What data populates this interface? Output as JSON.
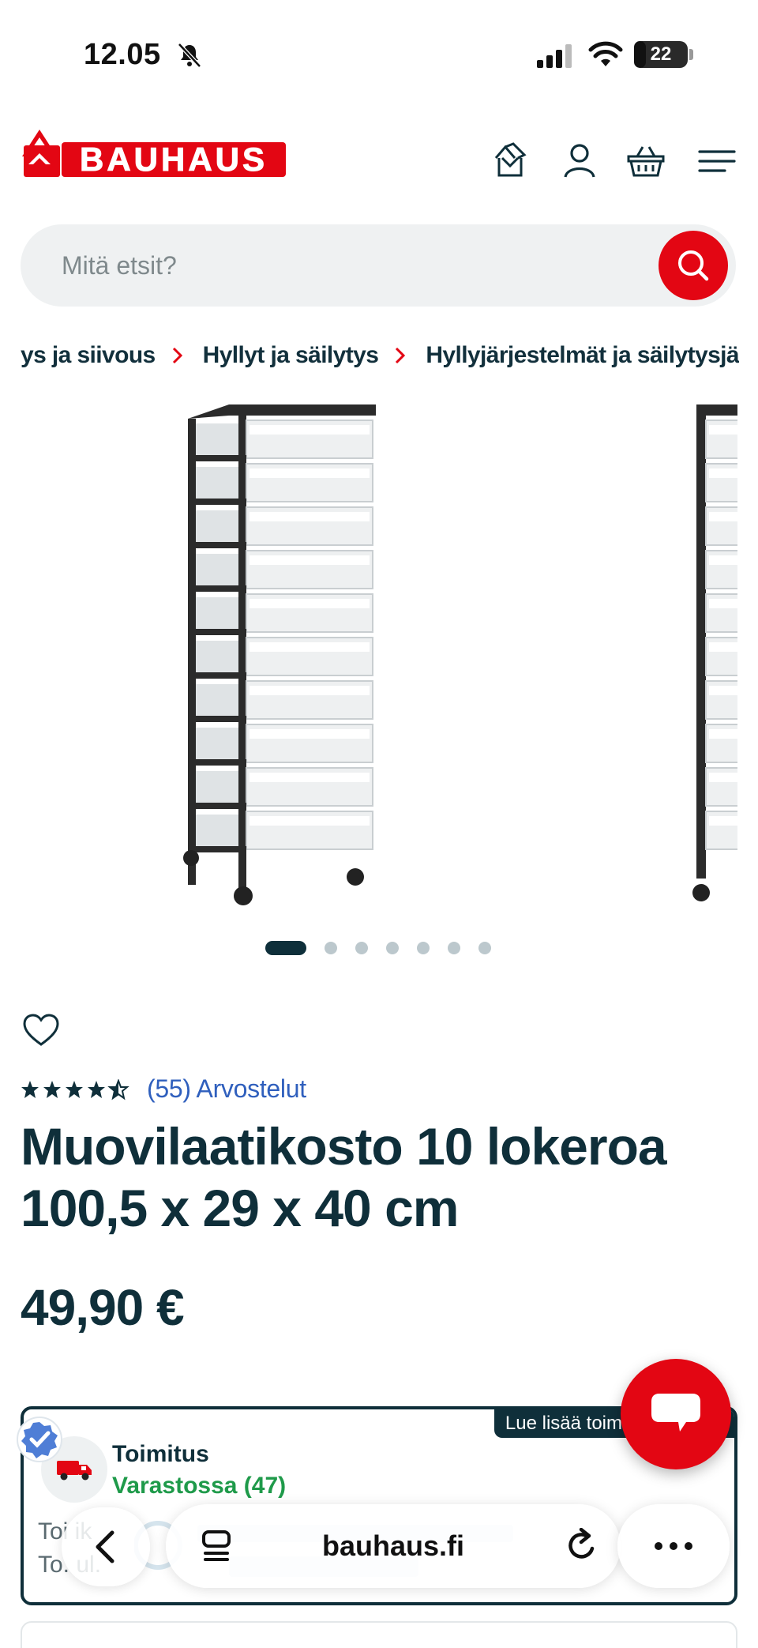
{
  "status_bar": {
    "time": "12.05",
    "battery": "22",
    "battery_level": 0.22
  },
  "header": {
    "logo_text": "BAUHAUS",
    "icons": [
      "store-icon",
      "account-icon",
      "basket-icon",
      "menu-icon"
    ]
  },
  "search": {
    "placeholder": "Mitä etsit?"
  },
  "breadcrumb": [
    "ys ja siivous",
    "Hyllyt ja säilytys",
    "Hyllyjärjestelmät ja säilytysjärjestelmät"
  ],
  "gallery": {
    "image_count": 7,
    "active_index": 0
  },
  "product": {
    "rating": 4.5,
    "reviews_link": "(55) Arvostelut",
    "title": "Muovilaatikosto 10 lokeroa 100,5 x 29 x 40 cm",
    "price": "49,90 €"
  },
  "delivery": {
    "tab_label": "Lue lisää toimit",
    "title": "Toimitus",
    "stock": "Varastossa (47)",
    "row1": "Toi   ik",
    "row2": "To.   ul."
  },
  "browser": {
    "url": "bauhaus.fi"
  },
  "colors": {
    "brand_red": "#e30613",
    "text_dark": "#0f2f3a",
    "link_blue": "#2f5fbd",
    "stock_green": "#1f9a4a"
  }
}
